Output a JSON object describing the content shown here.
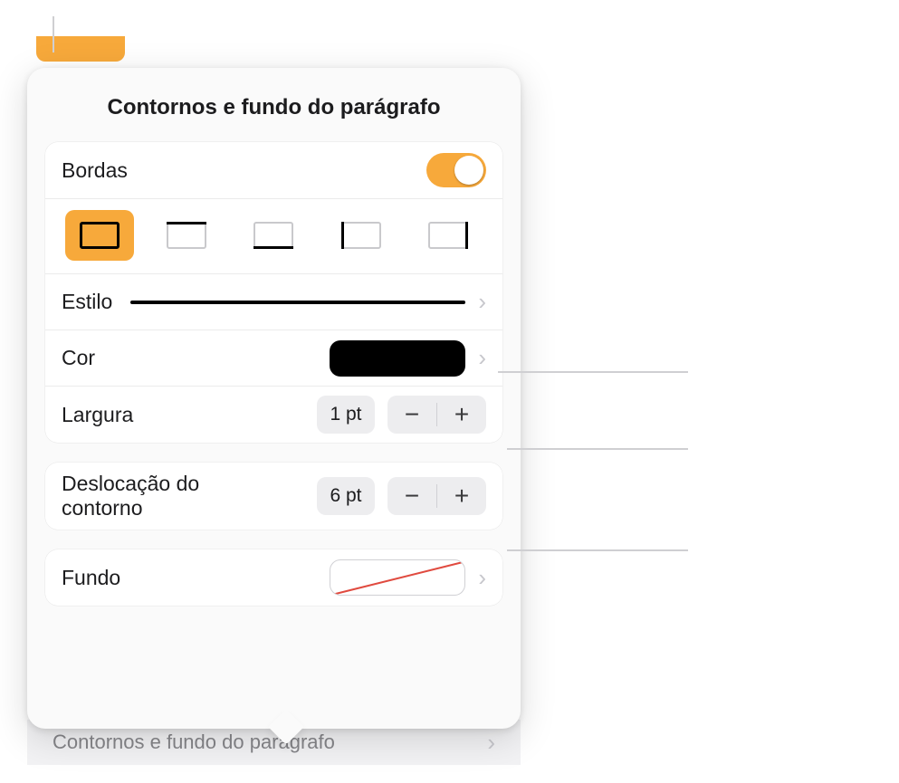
{
  "popover": {
    "title": "Contornos e fundo do parágrafo",
    "borders": {
      "label": "Bordas",
      "enabled": true,
      "positions": [
        "all",
        "top",
        "bottom",
        "left",
        "right"
      ],
      "active_index": 0
    },
    "style": {
      "label": "Estilo"
    },
    "color": {
      "label": "Cor",
      "value_hex": "#000000"
    },
    "width": {
      "label": "Largura",
      "value": "1 pt"
    },
    "offset": {
      "label": "Deslocação do\ncontorno",
      "value": "6 pt"
    },
    "fill": {
      "label": "Fundo",
      "value": "none"
    }
  },
  "behind_row": {
    "label": "Contornos e fundo do parágrafo"
  }
}
